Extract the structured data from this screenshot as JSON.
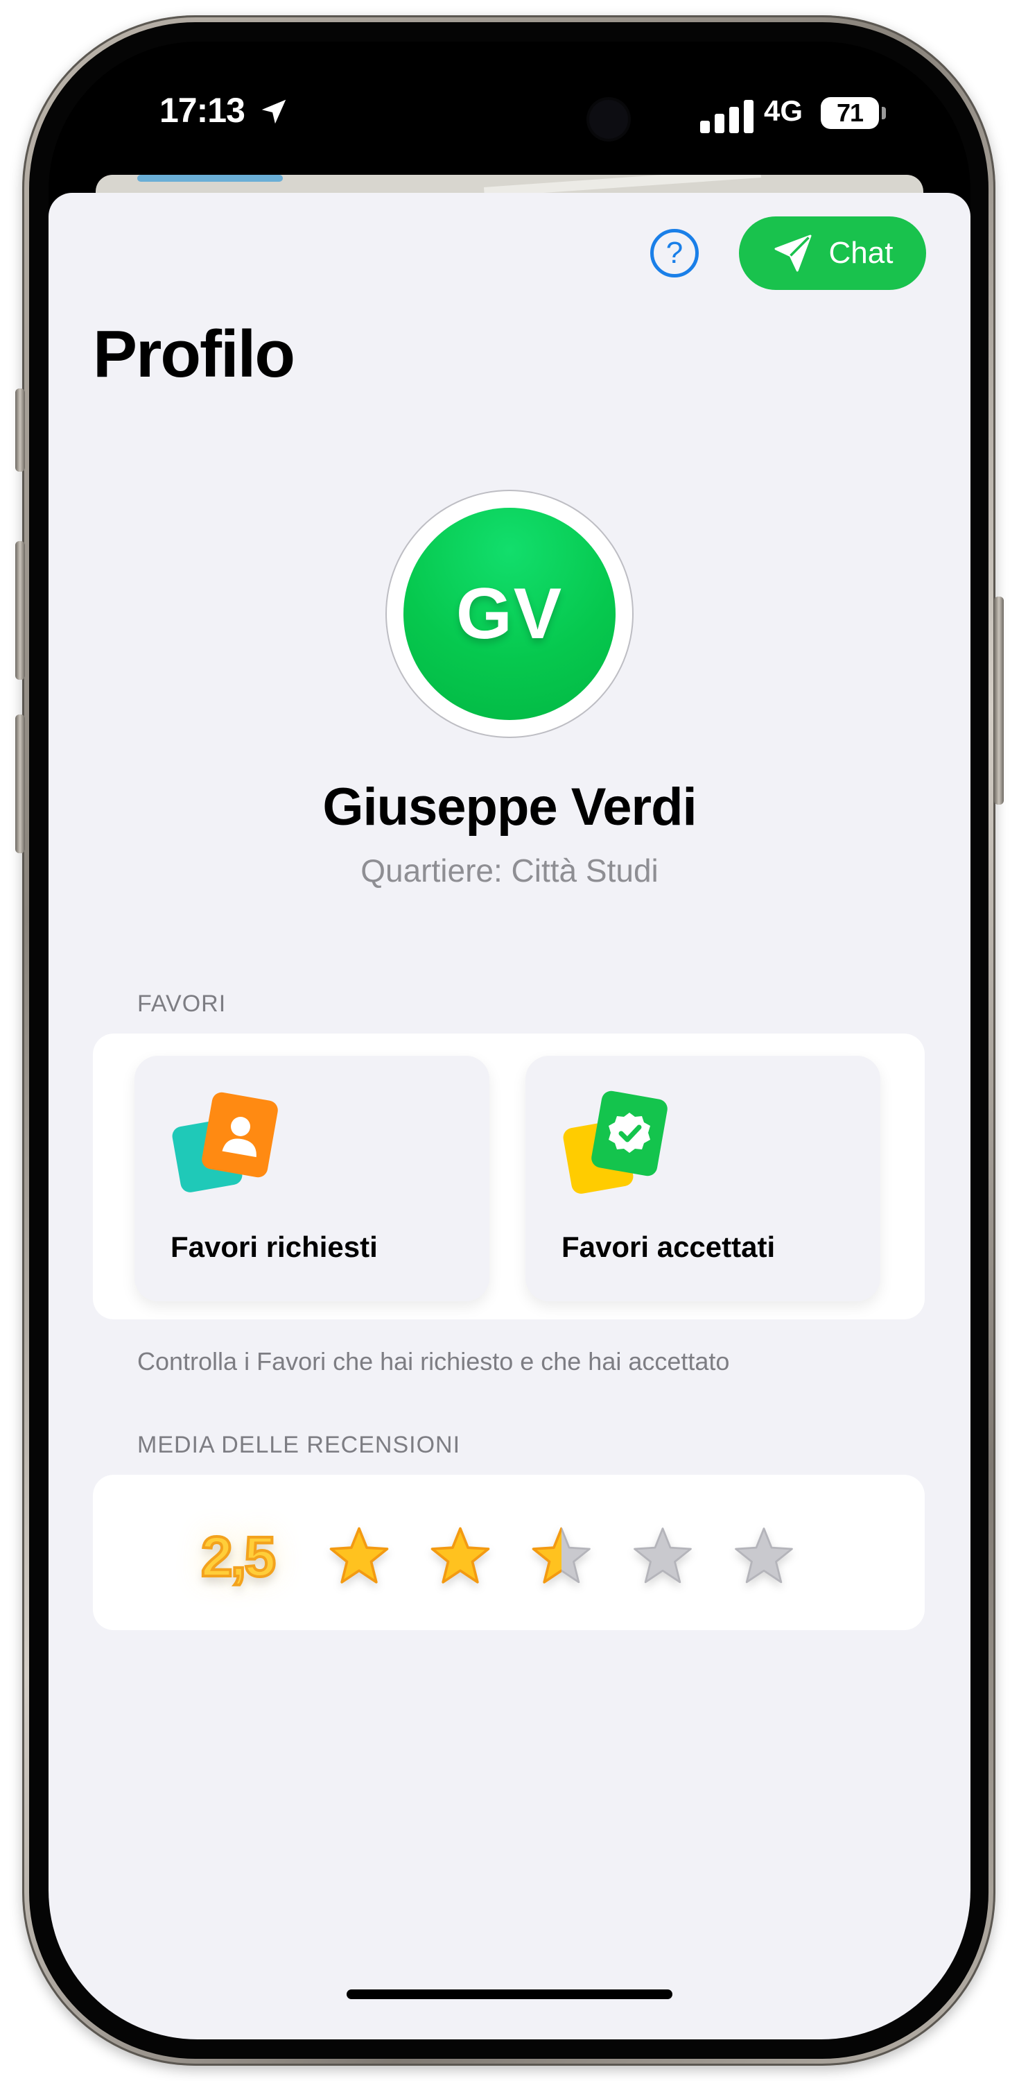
{
  "status_bar": {
    "time": "17:13",
    "network": "4G",
    "battery": "71"
  },
  "header": {
    "help_label": "?",
    "chat_label": "Chat"
  },
  "page_title": "Profilo",
  "profile": {
    "initials": "GV",
    "name": "Giuseppe Verdi",
    "district": "Quartiere: Città Studi",
    "avatar_color": "#06c84e"
  },
  "favors": {
    "section_title": "FAVORI",
    "tiles": [
      {
        "label": "Favori richiesti",
        "icon": "requested-favors-icon"
      },
      {
        "label": "Favori accettati",
        "icon": "accepted-favors-icon"
      }
    ],
    "caption": "Controlla i Favori che hai richiesto e che hai accettato"
  },
  "reviews": {
    "section_title": "MEDIA DELLE RECENSIONI",
    "average": "2,5",
    "rating_value": 2.5,
    "rating_max": 5
  },
  "colors": {
    "accent_blue": "#1a7fe8",
    "accent_green": "#19c24d",
    "star_gold": "#ffc21f",
    "star_empty": "#c9c9ce"
  }
}
